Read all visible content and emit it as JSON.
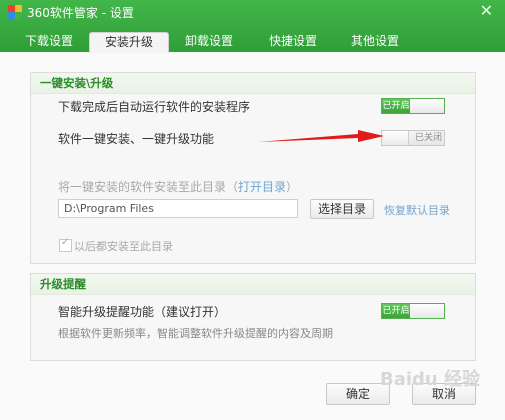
{
  "window": {
    "title": "360软件管家 - 设置",
    "close_glyph": "✕",
    "icon_colors": [
      "#e8412c",
      "#f5b72e",
      "#2f8fdd",
      "#40b44a"
    ]
  },
  "tabs": [
    {
      "label": "下载设置",
      "active": false
    },
    {
      "label": "安装升级",
      "active": true
    },
    {
      "label": "卸载设置",
      "active": false
    },
    {
      "label": "快捷设置",
      "active": false
    },
    {
      "label": "其他设置",
      "active": false
    }
  ],
  "install_section": {
    "title": "一键安装\\升级",
    "auto_run_label": "下载完成后自动运行软件的安装程序",
    "auto_run_state": "已开启",
    "one_click_label": "软件一键安装、一键升级功能",
    "one_click_state": "已关闭",
    "dir_prefix": "将一键安装的软件安装至此目录（",
    "open_dir_link": "打开目录",
    "dir_suffix": "）",
    "path_value": "D:\\Program Files",
    "choose_dir_button": "选择目录",
    "restore_default_link": "恢复默认目录",
    "always_install_label": "以后都安装至此目录"
  },
  "upgrade_section": {
    "title": "升级提醒",
    "smart_label": "智能升级提醒功能（建议打开）",
    "smart_state": "已开启",
    "smart_desc": "根据软件更新频率，智能调整软件升级提醒的内容及周期"
  },
  "footer": {
    "ok_button": "确定",
    "cancel_button": "取消"
  },
  "colors": {
    "accent_green": "#3aa23a",
    "arrow_red": "#e01b1b"
  },
  "watermark": "Baidu 经验"
}
